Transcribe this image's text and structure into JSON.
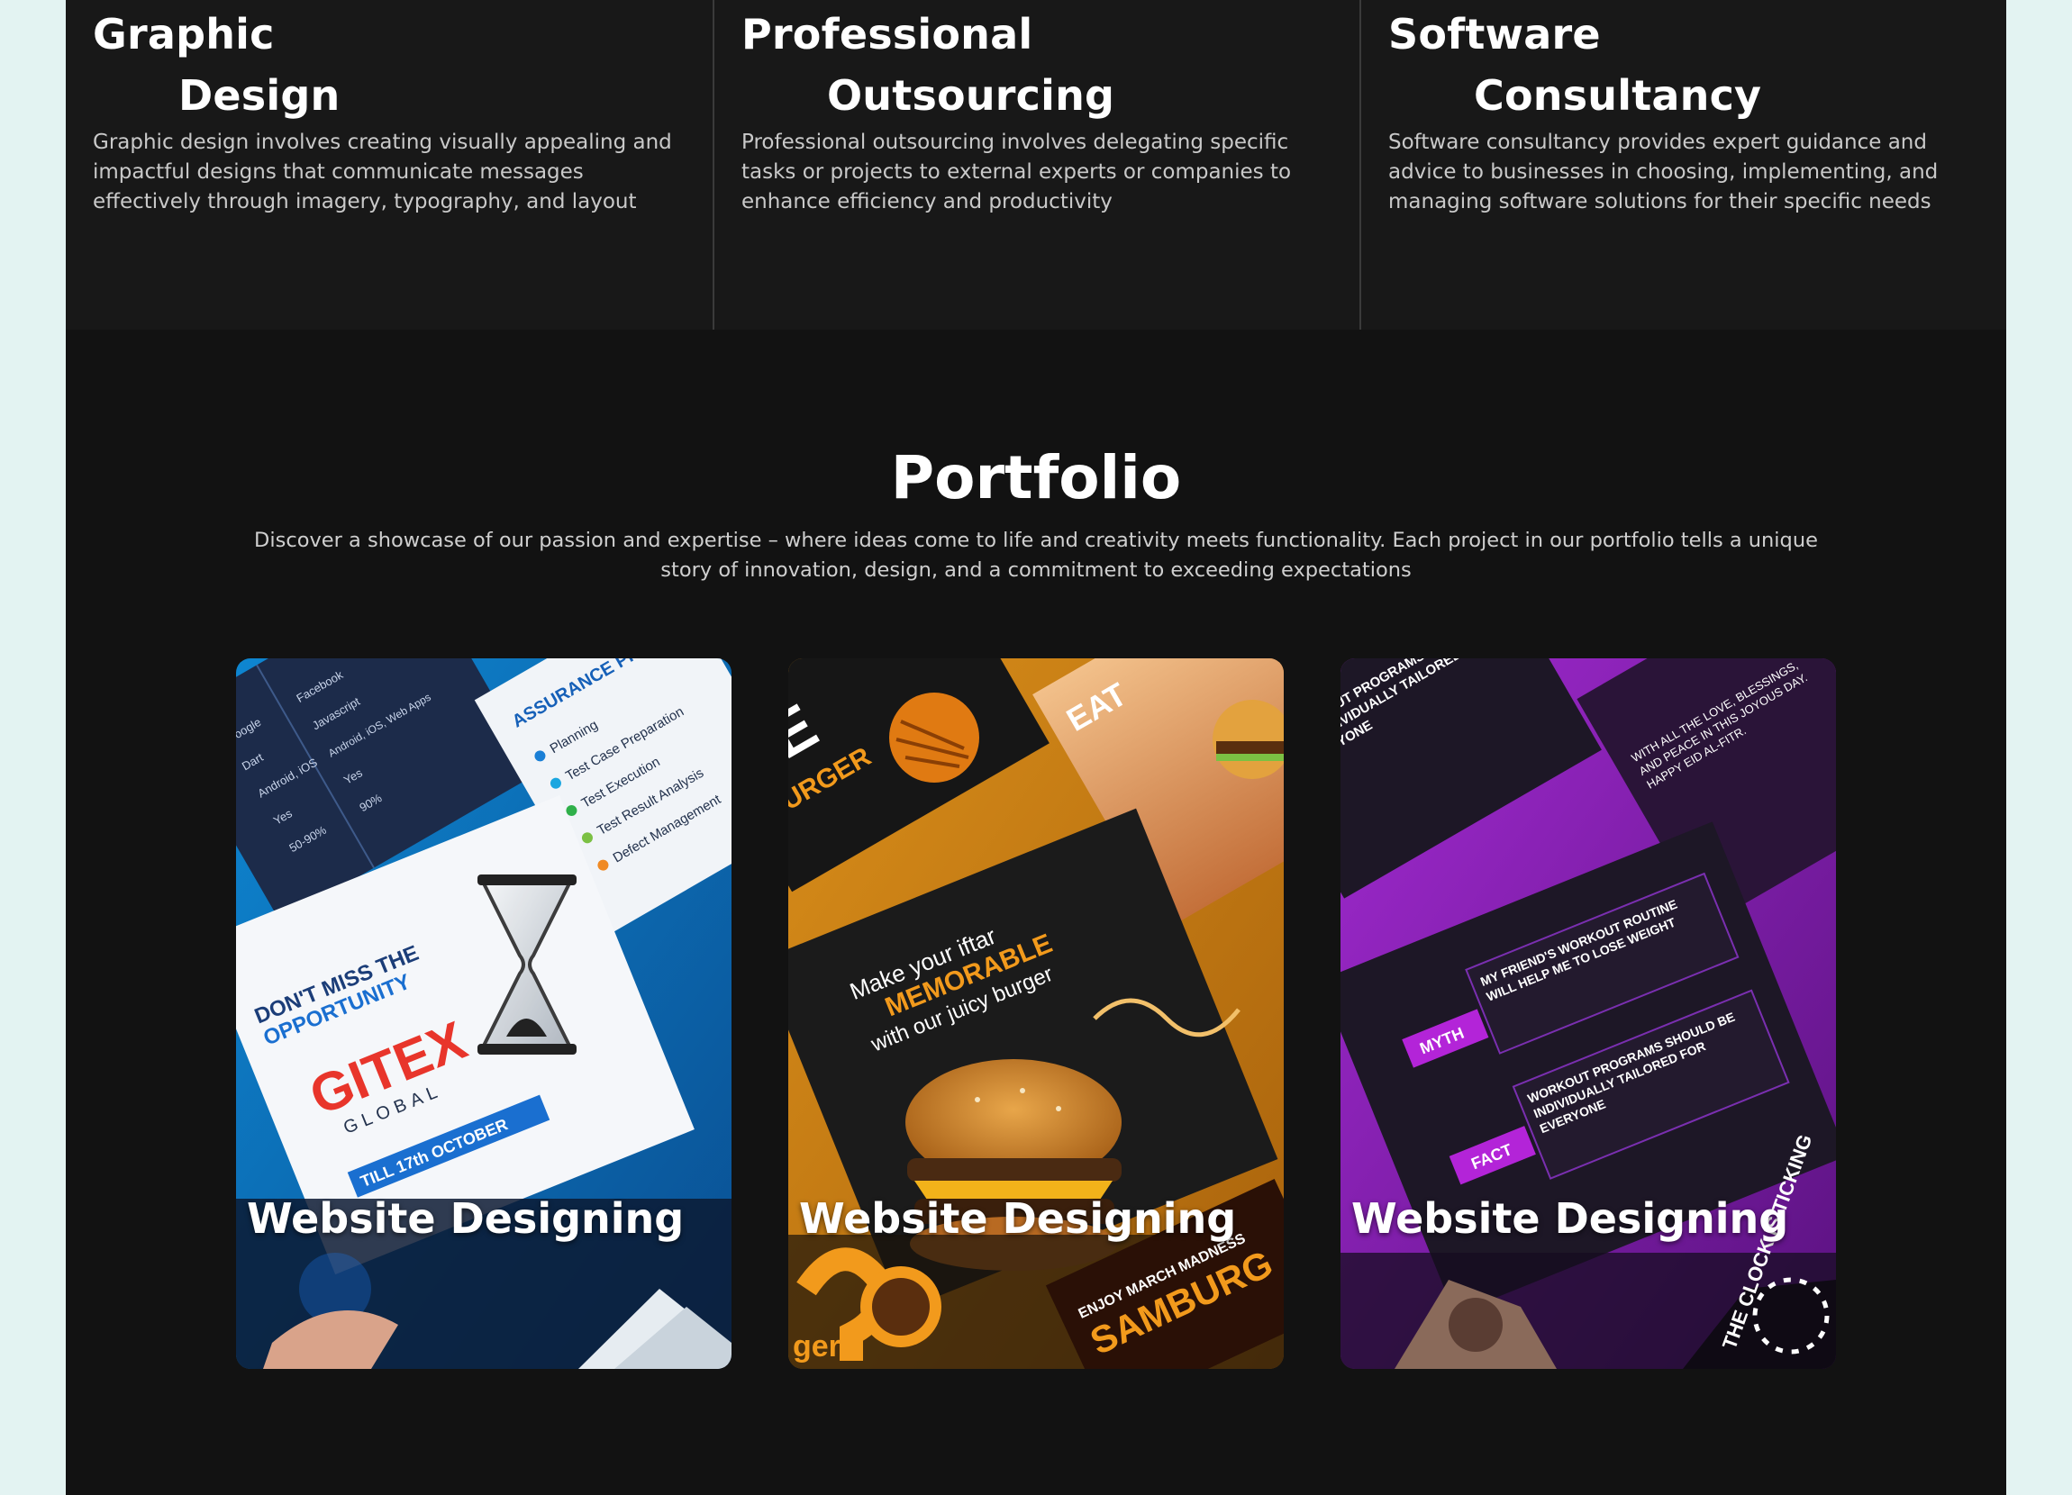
{
  "services": [
    {
      "title_line1": "Graphic",
      "title_line2": "Design",
      "description": "Graphic design involves creating visually appealing and impactful designs that communicate messages effectively through imagery, typography, and layout"
    },
    {
      "title_line1": "Professional",
      "title_line2": "Outsourcing",
      "description": "Professional outsourcing involves delegating specific tasks or projects to external experts or companies to enhance efficiency and productivity"
    },
    {
      "title_line1": "Software",
      "title_line2": "Consultancy",
      "description": "Software consultancy provides expert guidance and advice to businesses in choosing, implementing, and managing software solutions for their specific needs"
    }
  ],
  "portfolio": {
    "title": "Portfolio",
    "description": "Discover a showcase of our passion and expertise – where ideas come to life and creativity meets functionality. Each project in our portfolio tells a unique story of innovation, design, and a commitment to exceeding expectations",
    "items": [
      {
        "label": "Website Designing",
        "theme": "blue",
        "colors": {
          "base": "#0a5fa8",
          "accent": "#1fa3e6",
          "panel": "#eef3f8",
          "dark": "#1c2b4a"
        },
        "artwork_text": {
          "headline1": "DON'T MISS THE",
          "headline2": "OPPORTUNITY",
          "brand": "GITEX",
          "brand_sub": "GLOBAL",
          "date": "TILL 17th OCTOBER",
          "process_title": "ASSURANCE PROCESS",
          "steps": [
            "Planning",
            "Test Case Preparation",
            "Test Execution",
            "Test Result Analysis",
            "Defect Management"
          ],
          "dark_left": [
            "Google",
            "Dart",
            "Android, iOS",
            "Yes",
            "50-90%"
          ],
          "dark_right": [
            "Facebook",
            "Javascript",
            "Android, iOS, Web Apps",
            "Yes",
            "90%"
          ]
        }
      },
      {
        "label": "Website Designing",
        "theme": "orange",
        "colors": {
          "base": "#c97c12",
          "accent": "#f29a1c",
          "panel": "#1b1b1b",
          "dark": "#0d0d0d"
        },
        "artwork_text": {
          "line1": "Make your iftar",
          "line2": "MEMORABLE",
          "line3": "with our juicy burger",
          "top_word": "BURGER",
          "top_big": "VE",
          "corner": "EAT",
          "bottom1": "ENJOY MARCH MADNESS",
          "bottom2": "SAMBURG",
          "bottom_left": "ger"
        }
      },
      {
        "label": "Website Designing",
        "theme": "purple",
        "colors": {
          "base": "#7b1ea8",
          "accent": "#c23be0",
          "panel": "#1d1726",
          "dark": "#120c18"
        },
        "artwork_text": {
          "top_left": "WORKOUT PROGRAMS SHOULD BE INDIVIDUALLY TAILORED FOR EVERYONE",
          "myth_tag": "MYTH",
          "myth_text": "MY FRIEND'S WORKOUT ROUTINE WILL HELP ME TO LOSE WEIGHT",
          "fact_tag": "FACT",
          "fact_text": "WORKOUT PROGRAMS SHOULD BE INDIVIDUALLY TAILORED FOR EVERYONE",
          "eid": "WITH ALL THE LOVE, BLESSINGS, AND PEACE IN THIS JOYOUS DAY. HAPPY EID AL-FITR.",
          "clock": "THE CLOCK IS TICKING"
        }
      }
    ]
  }
}
